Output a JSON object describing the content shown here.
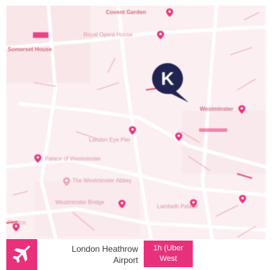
{
  "map": {
    "labels": [
      {
        "id": "label-top",
        "text": "Covent Garden"
      },
      {
        "id": "label-upper",
        "text": "Royal Opera House"
      },
      {
        "id": "label-left",
        "text": "Somerset House"
      },
      {
        "id": "label-mid",
        "text": "London Eye Pier"
      },
      {
        "id": "label-right",
        "text": "Westminster"
      },
      {
        "id": "label-lower1",
        "text": "Palace of Westminster"
      },
      {
        "id": "label-lower2",
        "text": "The Westminster Abbey"
      },
      {
        "id": "label-lower3",
        "text": "Westminster Bridge"
      },
      {
        "id": "label-lower4",
        "text": "Lambeth Palace"
      },
      {
        "id": "label-bottomleft",
        "text": "Pimlico"
      }
    ],
    "brand_marker_letter": "K",
    "accent_color": "#e8317a",
    "marker_color": "#1f2451"
  },
  "footer": {
    "airport_icon": "airplane-icon",
    "airport_name_line1": "London Heathrow",
    "airport_name_line2": "Airport",
    "time_line1": "1h (Uber",
    "time_line2": "West"
  }
}
